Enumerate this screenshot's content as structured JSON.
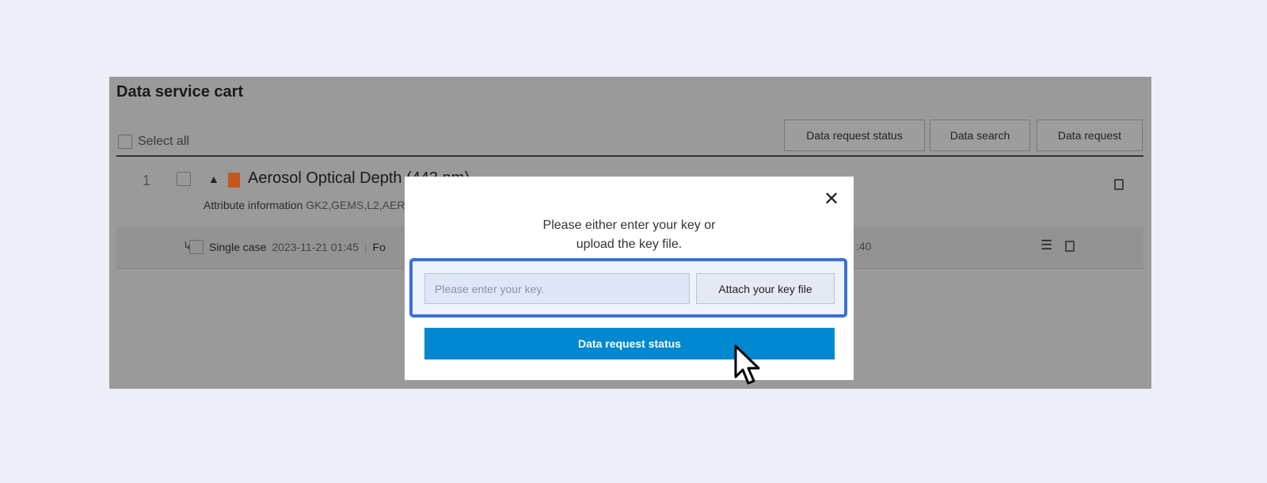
{
  "cart": {
    "title": "Data service cart",
    "select_all": "Select all",
    "buttons": {
      "status": "Data request status",
      "search": "Data search",
      "request": "Data request"
    },
    "item": {
      "index": "1",
      "title": "Aerosol Optical Depth (443 nm)",
      "attr_label": "Attribute information",
      "attr_value": "GK2,GEMS,L2,AER",
      "sub": {
        "type": "Single case",
        "date": "2023-11-21 01:45",
        "separator": "|",
        "fo": "Fo",
        "tail": ":40"
      }
    }
  },
  "modal": {
    "message_line1": "Please either enter your key or",
    "message_line2": "upload the key file.",
    "key_placeholder": "Please enter your key.",
    "attach_label": "Attach your key file",
    "submit_label": "Data request status",
    "highlight_color": "#3a6fd8",
    "primary_color": "#0088d1"
  }
}
